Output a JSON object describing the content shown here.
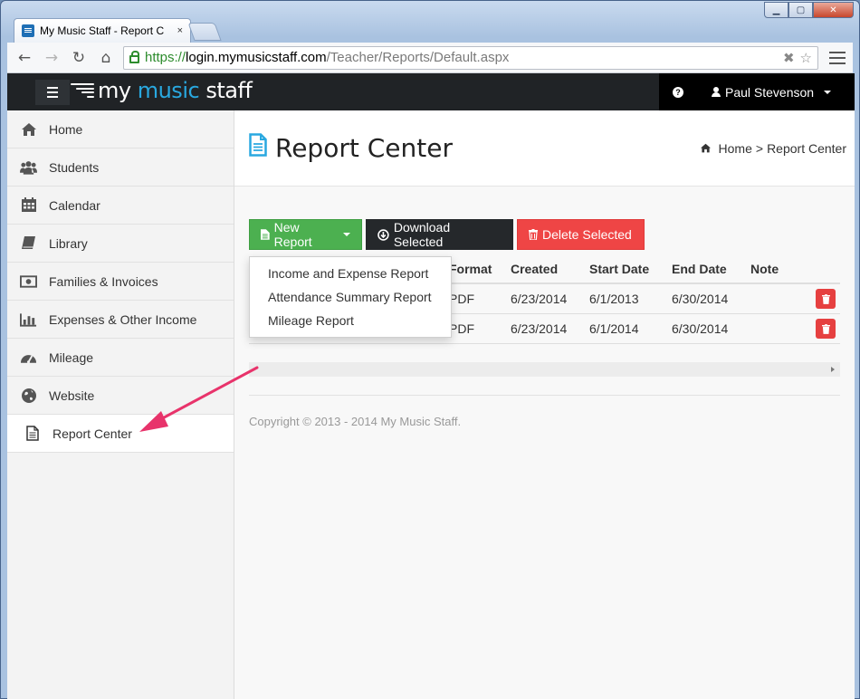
{
  "browser": {
    "tab_title": "My Music Staff - Report C",
    "tab_close": "×",
    "url_scheme": "https://",
    "url_host": "login.mymusicstaff.com",
    "url_path": "/Teacher/Reports/Default.aspx"
  },
  "app": {
    "logo_pre": "my ",
    "logo_accent": "music",
    "logo_post": " staff",
    "user_name": "Paul Stevenson"
  },
  "sidebar": {
    "items": [
      {
        "label": "Home",
        "icon": "home-icon"
      },
      {
        "label": "Students",
        "icon": "users-icon"
      },
      {
        "label": "Calendar",
        "icon": "calendar-icon"
      },
      {
        "label": "Library",
        "icon": "book-icon"
      },
      {
        "label": "Families & Invoices",
        "icon": "money-icon"
      },
      {
        "label": "Expenses & Other Income",
        "icon": "bar-chart-icon"
      },
      {
        "label": "Mileage",
        "icon": "dashboard-icon"
      },
      {
        "label": "Website",
        "icon": "globe-icon"
      },
      {
        "label": "Report Center",
        "icon": "file-icon"
      }
    ]
  },
  "page": {
    "title": "Report Center",
    "breadcrumb_home": "Home",
    "breadcrumb_sep": ">",
    "breadcrumb_current": "Report Center"
  },
  "actions": {
    "new_report": "New Report",
    "download_selected": "Download Selected",
    "delete_selected": "Delete Selected"
  },
  "new_report_menu": [
    "Income and Expense Report",
    "Attendance Summary Report",
    "Mileage Report"
  ],
  "table": {
    "headers": {
      "format": "Format",
      "created": "Created",
      "start": "Start Date",
      "end": "End Date",
      "note": "Note"
    },
    "rows": [
      {
        "format": "PDF",
        "created": "6/23/2014",
        "start": "6/1/2013",
        "end": "6/30/2014"
      },
      {
        "format": "PDF",
        "created": "6/23/2014",
        "start": "6/1/2014",
        "end": "6/30/2014"
      }
    ]
  },
  "footer": {
    "copyright": "Copyright © 2013 - 2014 My Music Staff."
  },
  "colors": {
    "green": "#4cb050",
    "dark": "#25282b",
    "red": "#ef4545",
    "accent_blue": "#29a8e0",
    "annotation_arrow": "#e8336b"
  }
}
